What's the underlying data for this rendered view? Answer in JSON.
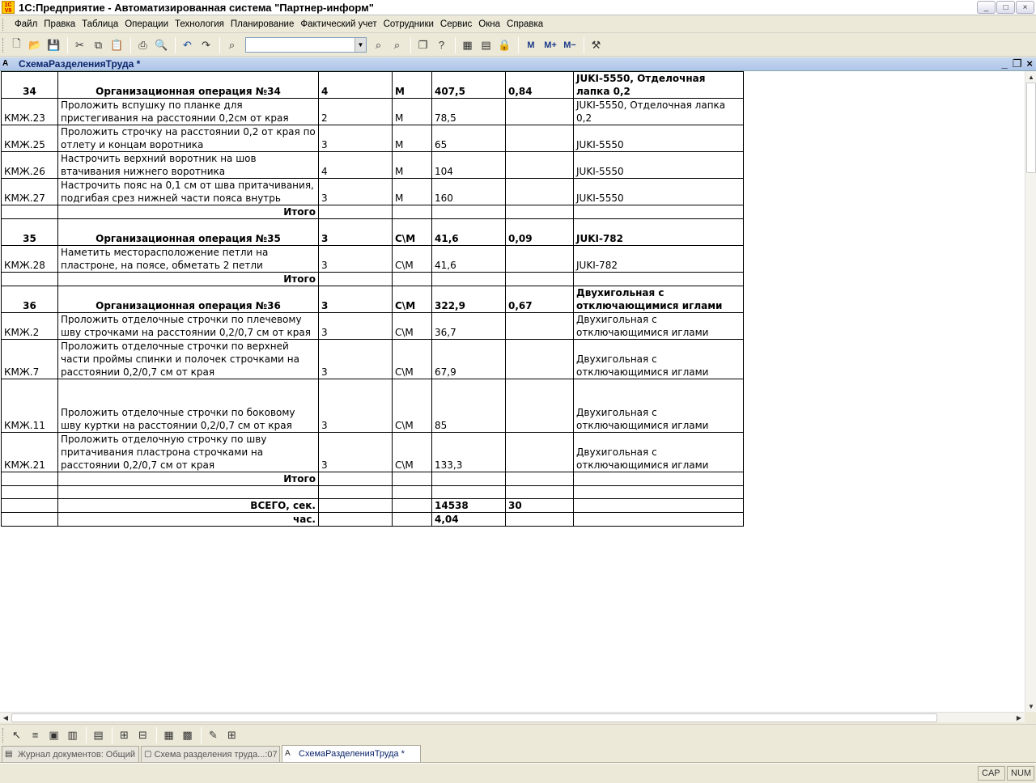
{
  "window": {
    "title": "1С:Предприятие - Автоматизированная система \"Партнер-информ\"",
    "app_icon": "1c-icon",
    "minimize": "_",
    "maximize": "□",
    "close": "×"
  },
  "menu": [
    "Файл",
    "Правка",
    "Таблица",
    "Операции",
    "Технология",
    "Планирование",
    "Фактический учет",
    "Сотрудники",
    "Сервис",
    "Окна",
    "Справка"
  ],
  "toolbar": {
    "search_value": "",
    "memory_buttons": [
      "M",
      "M+",
      "M−"
    ]
  },
  "document": {
    "title": "СхемаРазделенияТруда *",
    "min": "_",
    "restore": "❐",
    "close": "×"
  },
  "table": {
    "rows": [
      {
        "type": "op",
        "cells": [
          "34",
          "Организационная операция №34",
          "4",
          "М",
          "407,5",
          "0,84",
          "JUKI-5550, Отделочная лапка 0,2"
        ]
      },
      {
        "type": "item",
        "cells": [
          "КМЖ.23",
          "Проложить вспушку по планке для пристегивания на расстоянии 0,2см от края",
          "2",
          "М",
          "78,5",
          "",
          "JUKI-5550, Отделочная лапка 0,2"
        ]
      },
      {
        "type": "item",
        "cells": [
          "КМЖ.25",
          "Проложить строчку на расстоянии 0,2 от края по отлету и концам воротника",
          "3",
          "М",
          "65",
          "",
          "JUKI-5550"
        ]
      },
      {
        "type": "item",
        "cells": [
          "КМЖ.26",
          "Настрочить верхний воротник на шов втачивания нижнего воротника",
          "4",
          "М",
          "104",
          "",
          "JUKI-5550"
        ]
      },
      {
        "type": "item",
        "cells": [
          "КМЖ.27",
          "Настрочить пояс на 0,1 см от шва притачивания, подгибая срез нижней части пояса внутрь",
          "3",
          "М",
          "160",
          "",
          "JUKI-5550"
        ]
      },
      {
        "type": "total",
        "cells": [
          "",
          "Итого",
          "",
          "",
          "",
          "",
          ""
        ]
      },
      {
        "type": "op",
        "cells": [
          "35",
          "Организационная операция №35",
          "3",
          "С\\М",
          "41,6",
          "0,09",
          "JUKI-782"
        ]
      },
      {
        "type": "item",
        "cells": [
          "КМЖ.28",
          "Наметить месторасположение петли на пластроне, на поясе, обметать 2 петли",
          "3",
          "С\\М",
          "41,6",
          "",
          "JUKI-782"
        ]
      },
      {
        "type": "total",
        "cells": [
          "",
          "Итого",
          "",
          "",
          "",
          "",
          ""
        ]
      },
      {
        "type": "op",
        "cells": [
          "36",
          "Организационная операция №36",
          "3",
          "С\\М",
          "322,9",
          "0,67",
          "Двухигольная с отключающимися иглами"
        ]
      },
      {
        "type": "item",
        "cells": [
          "КМЖ.2",
          "Проложить отделочные строчки по плечевому шву строчками на расстоянии 0,2/0,7 см от края",
          "3",
          "С\\М",
          "36,7",
          "",
          "Двухигольная с отключающимися иглами"
        ]
      },
      {
        "type": "item",
        "cells": [
          "КМЖ.7",
          "Проложить отделочные строчки по верхней части проймы спинки и полочек строчками на расстоянии 0,2/0,7 см от края",
          "3",
          "С\\М",
          "67,9",
          "",
          "Двухигольная с отключающимися иглами"
        ]
      },
      {
        "type": "item-tall",
        "cells": [
          "КМЖ.11",
          "Проложить отделочные строчки по боковому шву куртки на расстоянии 0,2/0,7 см от края",
          "3",
          "С\\М",
          "85",
          "",
          "Двухигольная с отключающимися иглами"
        ]
      },
      {
        "type": "item",
        "cells": [
          "КМЖ.21",
          "Проложить отделочную строчку по шву притачивания пластрона строчками на расстоянии 0,2/0,7 см от края",
          "3",
          "С\\М",
          "133,3",
          "",
          "Двухигольная с отключающимися иглами"
        ]
      },
      {
        "type": "total",
        "cells": [
          "",
          "Итого",
          "",
          "",
          "",
          "",
          ""
        ]
      },
      {
        "type": "blank",
        "cells": [
          "",
          "",
          "",
          "",
          "",
          "",
          ""
        ]
      },
      {
        "type": "grand",
        "cells": [
          "",
          "ВСЕГО, сек.",
          "",
          "",
          "14538",
          "30",
          ""
        ]
      },
      {
        "type": "grand",
        "cells": [
          "",
          "час.",
          "",
          "",
          "4,04",
          "",
          ""
        ]
      }
    ]
  },
  "tasks": [
    {
      "label": "Журнал документов: Общий",
      "active": false
    },
    {
      "label": "Схема разделения труда...:07",
      "active": false
    },
    {
      "label": "СхемаРазделенияТруда *",
      "active": true
    }
  ],
  "status": {
    "cap": "CAP",
    "num": "NUM"
  }
}
